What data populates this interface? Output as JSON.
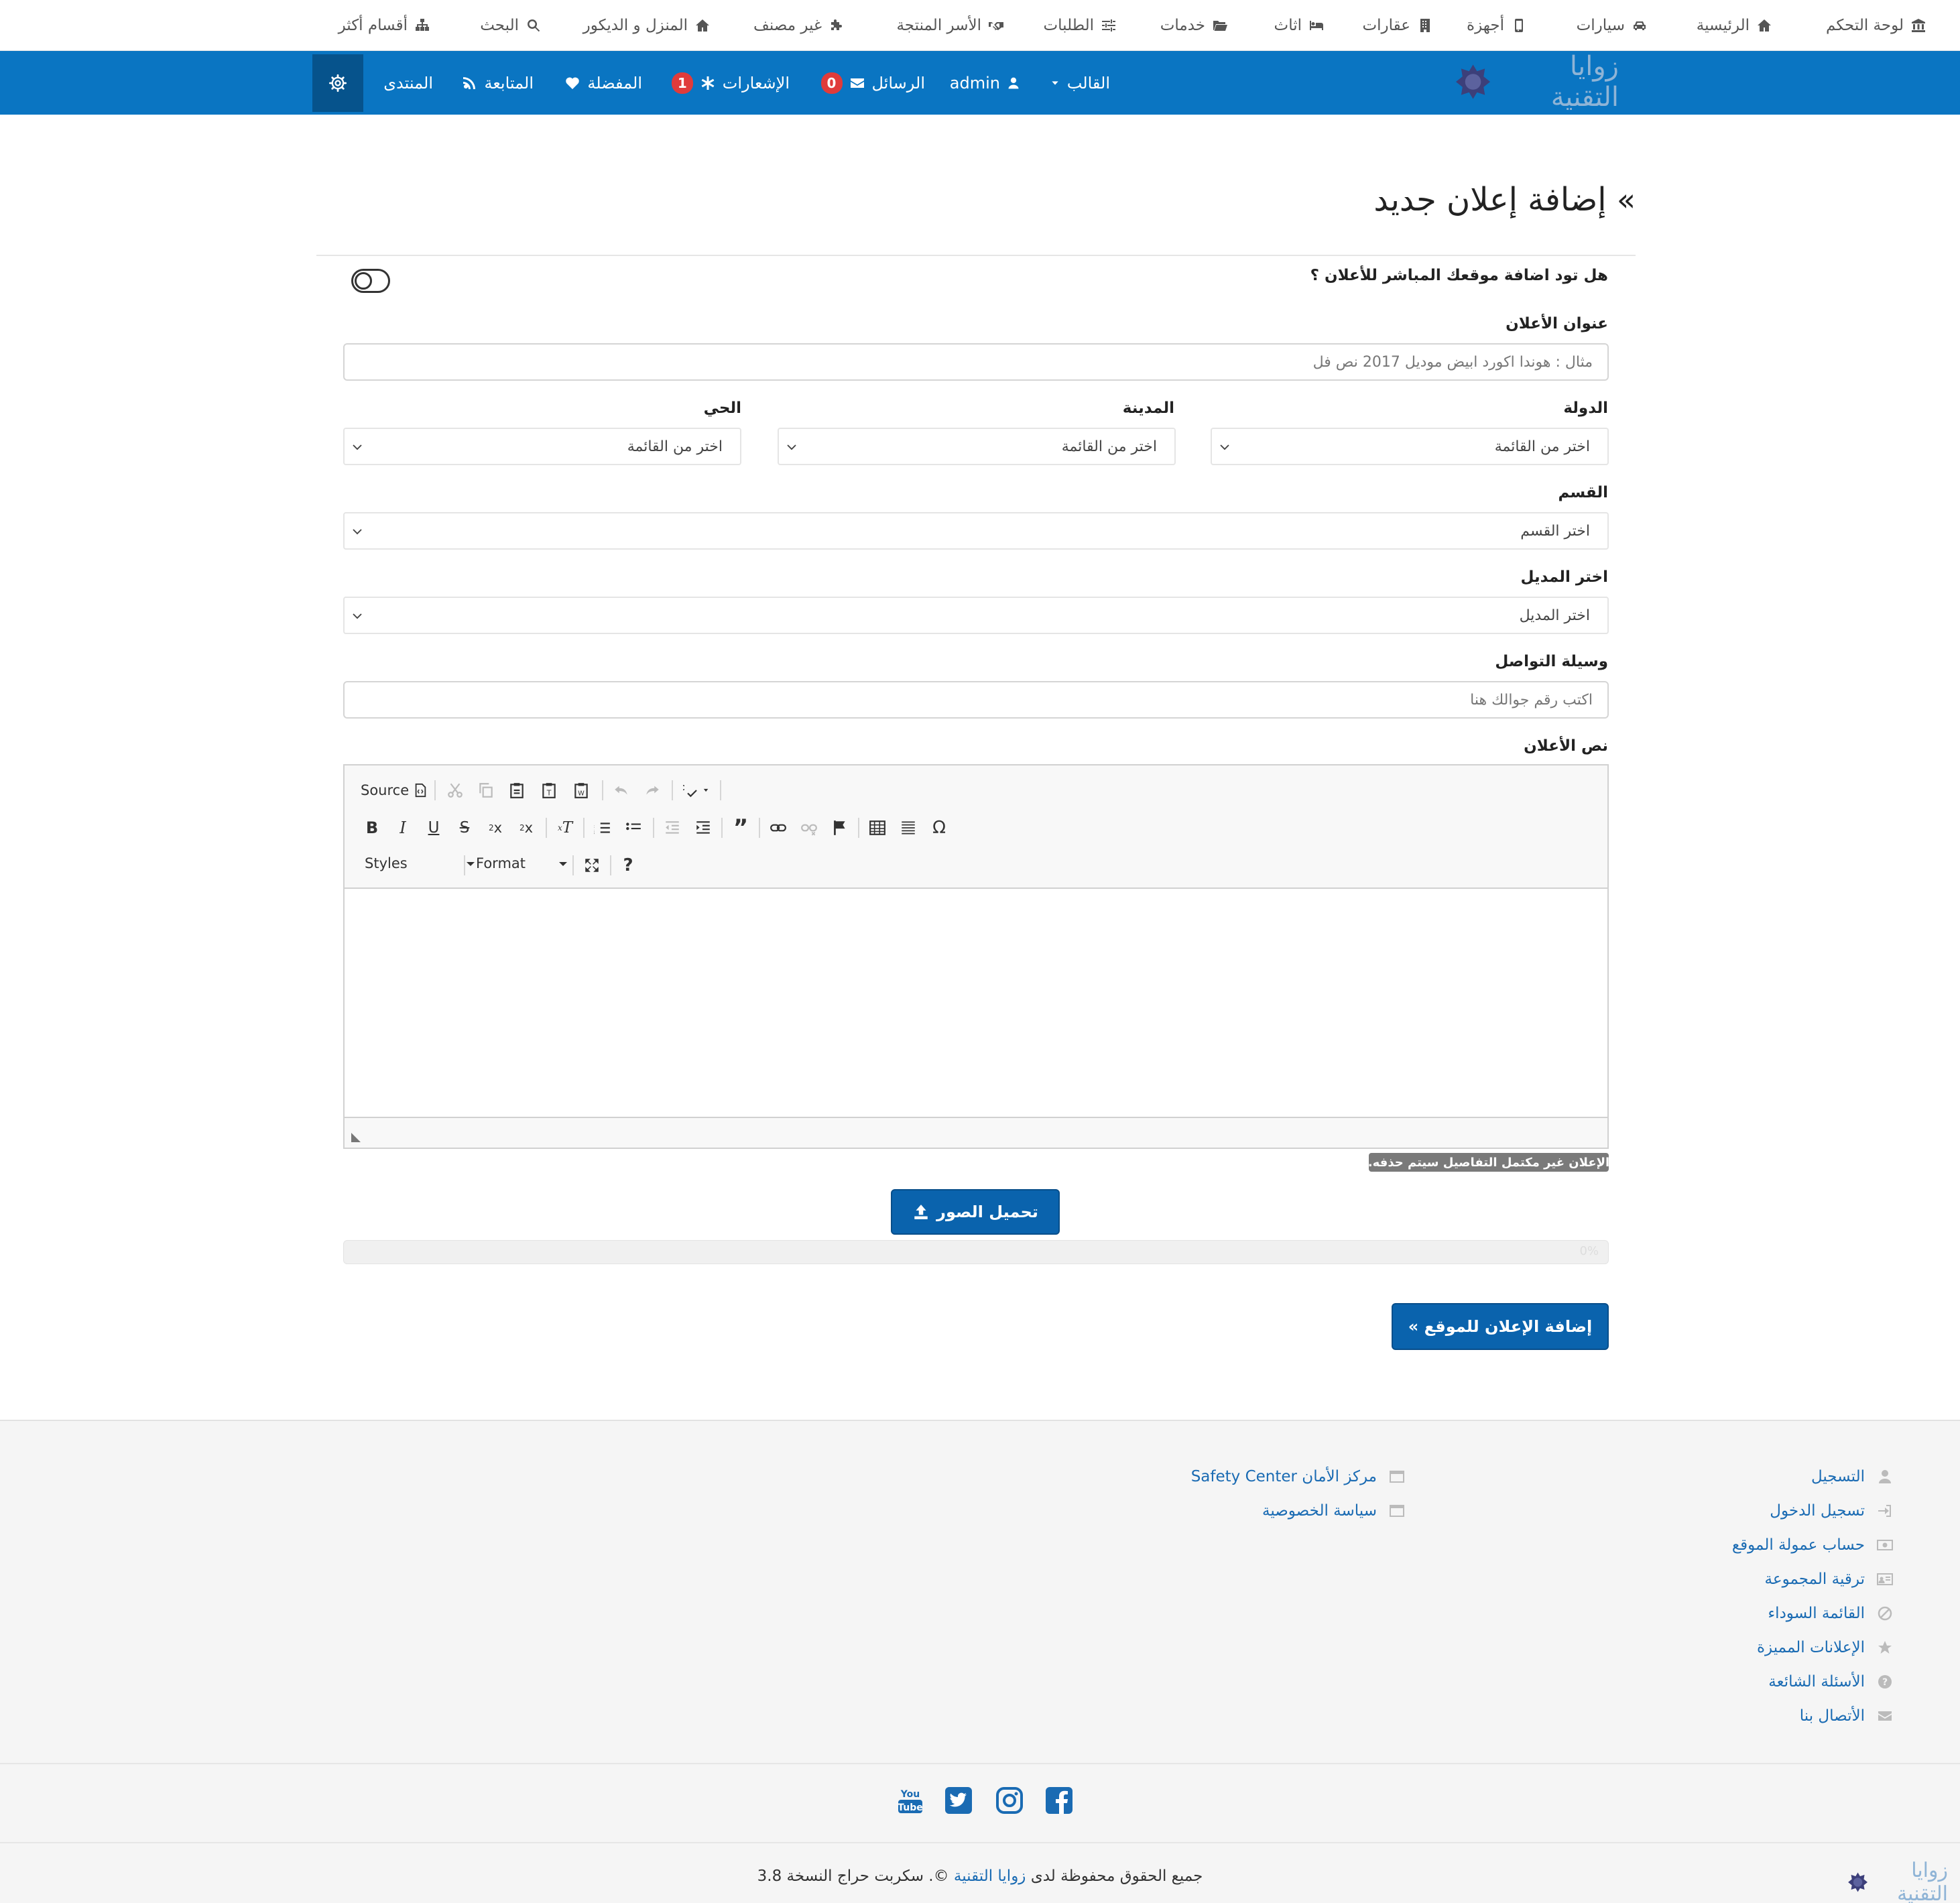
{
  "topnav": {
    "items": [
      {
        "label": "لوحة التحكم",
        "icon": "bank-icon"
      },
      {
        "label": "الرئيسية",
        "icon": "home-icon"
      },
      {
        "label": "سيارات",
        "icon": "car-icon"
      },
      {
        "label": "أجهزة",
        "icon": "mobile-icon"
      },
      {
        "label": "عقارات",
        "icon": "building-icon"
      },
      {
        "label": "اثاث",
        "icon": "bed-icon"
      },
      {
        "label": "خدمات",
        "icon": "folder-icon"
      },
      {
        "label": "الطلبات",
        "icon": "sliders-icon"
      },
      {
        "label": "الأسر المنتجة",
        "icon": "handshake-icon"
      },
      {
        "label": "غير مصنف",
        "icon": "puzzle-icon"
      },
      {
        "label": "المنزل و الديكور",
        "icon": "home-icon"
      },
      {
        "label": "البحث",
        "icon": "search-icon"
      },
      {
        "label": "أقسام أكثر",
        "icon": "sitemap-icon"
      }
    ]
  },
  "mainbar": {
    "logo_text": "زوايا التقنية",
    "template": "القالب",
    "user": "admin",
    "messages": "الرسائل",
    "messages_count": "0",
    "notifications": "الإشعارات",
    "notifications_count": "1",
    "favorites": "المفضلة",
    "following": "المتابعة",
    "forum": "المنتدى"
  },
  "form": {
    "heading": "إضافة إعلان جديد",
    "website_question": "هل تود اضافة موقعك المباشر للأعلان ؟",
    "title_label": "عنوان الأعلان",
    "title_placeholder": "مثال : هوندا اكورد ابيض موديل 2017 نص فل",
    "country_label": "الدولة",
    "country_value": "اختر من القائمة",
    "city_label": "المدينة",
    "city_value": "اختر من القائمة",
    "district_label": "الحي",
    "district_value": "اختر من القائمة",
    "category_label": "القسم",
    "category_value": "اختر القسم",
    "model_label": "اختر المديل",
    "model_value": "اختر المديل",
    "contact_label": "وسيلة التواصل",
    "contact_placeholder": "اكتب رقم جوالك هنا",
    "body_label": "نص الأعلان",
    "editor": {
      "source": "Source",
      "styles": "Styles",
      "format": "Format",
      "help": "?"
    },
    "warning": "الإعلان غير مكتمل التفاصيل سيتم حذفه.",
    "upload_button": "تحميل الصور",
    "progress_percent": 0,
    "progress_text": "0%",
    "submit_button": "إضافة الإعلان للموقع »"
  },
  "footer": {
    "col1": [
      {
        "label": "التسجيل",
        "icon": "user-icon"
      },
      {
        "label": "تسجيل الدخول",
        "icon": "sign-in-icon"
      },
      {
        "label": "حساب عمولة الموقع",
        "icon": "money-icon"
      },
      {
        "label": "ترقية المجموعة",
        "icon": "id-card-icon"
      },
      {
        "label": "القائمة السوداء",
        "icon": "ban-icon"
      },
      {
        "label": "الإعلانات المميزة",
        "icon": "star-icon"
      },
      {
        "label": "الأسئلة الشائعة",
        "icon": "question-icon"
      },
      {
        "label": "الأتصال بنا",
        "icon": "envelope-icon"
      }
    ],
    "col2": [
      {
        "label": "مركز الأمان Safety Center",
        "icon": "window-icon"
      },
      {
        "label": "سياسة الخصوصية",
        "icon": "window-icon"
      }
    ],
    "social": [
      "youtube-icon",
      "twitter-icon",
      "instagram-icon",
      "facebook-icon"
    ],
    "copyright_pre": "جميع الحقوق محفوظة لدى",
    "copyright_brand": "زوايا التقنية",
    "copyright_post": "©. سكربت حراج النسخة 3.8",
    "logo_text": "زوايا التقنية"
  },
  "colors": {
    "primary": "#0a75c2",
    "button": "#0a63ad",
    "badge": "#e03b3b",
    "link": "#1a6bb3"
  }
}
